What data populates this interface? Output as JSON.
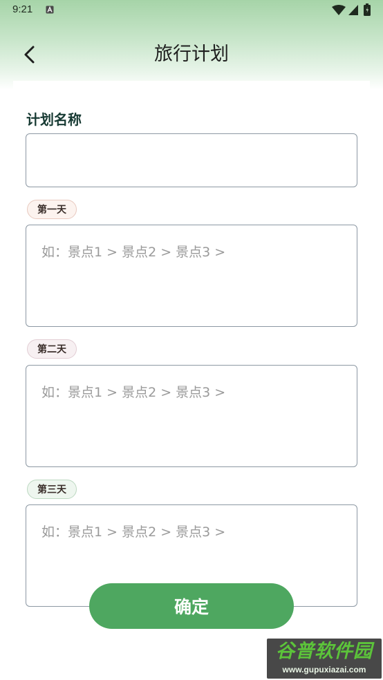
{
  "status_bar": {
    "time": "9:21",
    "notification_icon": "a-icon",
    "wifi_icon": "wifi-icon",
    "signal_icon": "signal-icon",
    "battery_icon": "battery-icon"
  },
  "header": {
    "back_icon": "chevron-left-icon",
    "title": "旅行计划"
  },
  "form": {
    "plan_name": {
      "label": "计划名称",
      "value": "",
      "placeholder": ""
    },
    "days": [
      {
        "badge": "第一天",
        "placeholder": "如：景点1 > 景点2 > 景点3 >",
        "value": ""
      },
      {
        "badge": "第二天",
        "placeholder": "如：景点1 > 景点2 > 景点3 >",
        "value": ""
      },
      {
        "badge": "第三天",
        "placeholder": "如：景点1 > 景点2 > 景点3 >",
        "value": ""
      }
    ],
    "confirm_label": "确定"
  },
  "watermark": {
    "brand": "谷普软件园",
    "url": "www.gupuxiazai.com"
  },
  "colors": {
    "accent": "#4ea760",
    "header_gradient": "#a6d4a8",
    "label_text": "#173a33",
    "border": "#8c98a3",
    "placeholder": "#9a9a9a"
  }
}
